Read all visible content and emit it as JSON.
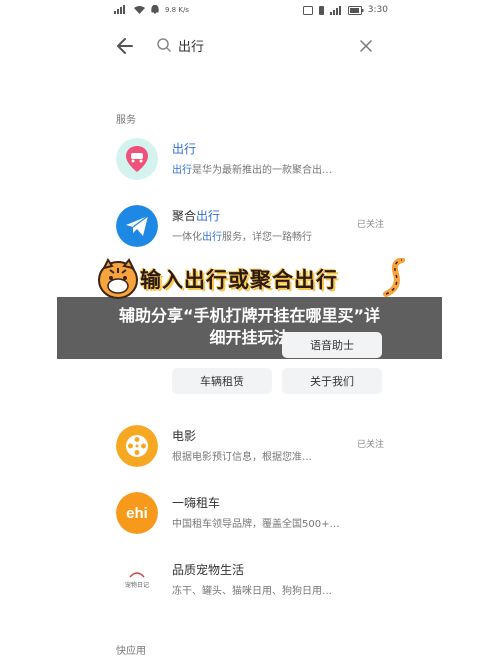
{
  "status_bar": {
    "left_text": "9.8 K/s",
    "right_text": "3:30"
  },
  "search": {
    "query": "出行"
  },
  "sections": {
    "services_label": "服务",
    "quick_apps_label": "快应用"
  },
  "results": [
    {
      "title_hl": "出行",
      "title_rest": "",
      "desc_pre": "",
      "desc_hl": "出行",
      "desc_post": "是华为最新推出的一款聚合出…",
      "badge": "",
      "icon": "map-pin-car-icon",
      "color": "#f0517a"
    },
    {
      "title_hl": "聚合",
      "title_rest": "出行",
      "desc_pre": "一体化",
      "desc_hl": "出行",
      "desc_post": "服务，详您一路畅行",
      "badge": "已关注",
      "icon": "paper-plane-icon",
      "color": "#1e88e5"
    },
    {
      "title_hl": "",
      "title_rest": "电影",
      "desc_pre": "根据电影预订信息，根据您准…",
      "desc_hl": "",
      "desc_post": "",
      "badge": "已关注",
      "icon": "film-reel-icon",
      "color": "#f7a823"
    },
    {
      "title_hl": "",
      "title_rest": "一嗨租车",
      "desc_pre": "中国租车领导品牌，覆盖全国500+…",
      "desc_hl": "",
      "desc_post": "",
      "badge": "",
      "icon": "ehi-logo-icon",
      "color": "#f79a1b"
    },
    {
      "title_hl": "",
      "title_rest": "品质宠物生活",
      "desc_pre": "冻干、罐头、猫咪日用、狗狗日用…",
      "desc_hl": "",
      "desc_post": "",
      "badge": "",
      "icon": "pet-logo-icon",
      "color": "#dddddd"
    }
  ],
  "chips": {
    "chip1": "语音助士",
    "chip2": "车辆租赁",
    "chip3": "关于我们"
  },
  "banner": {
    "text": "输入出行或聚合出行"
  },
  "overlay": {
    "line1": "辅助分享“手机打牌开挂在哪里买”详",
    "line2": "细开挂玩法"
  },
  "pet_logo_text": "宠物日记"
}
